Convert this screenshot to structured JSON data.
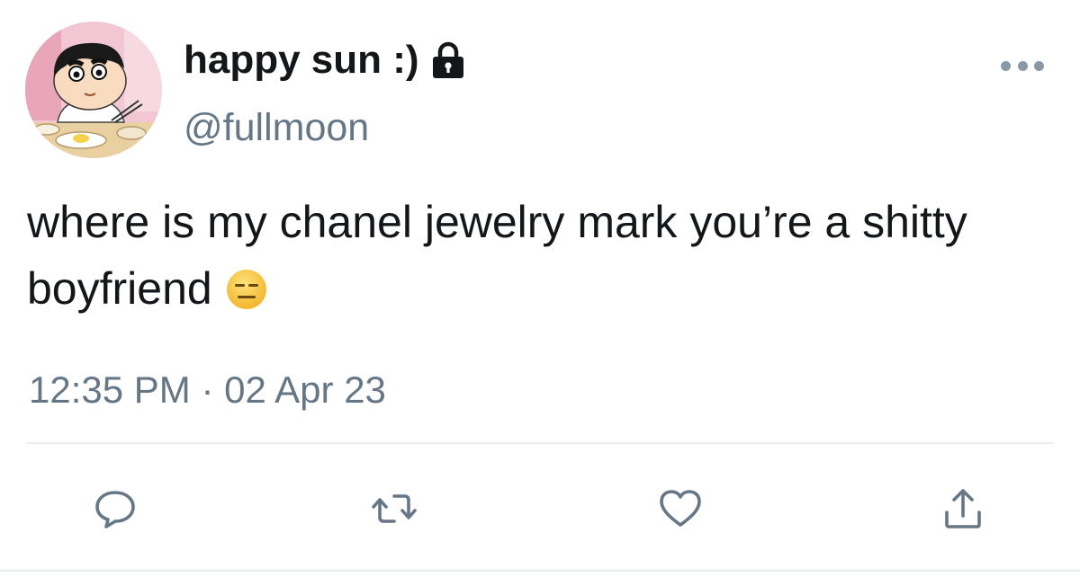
{
  "author": {
    "display_name": "happy sun :)",
    "handle": "@fullmoon",
    "protected_icon": "lock-icon",
    "avatar": "cartoon-boy-eating-avatar"
  },
  "tweet": {
    "text": "where is my chanel jewelry mark you’re a shitty boyfriend",
    "emoji": "expressionless-face-emoji",
    "timestamp": "12:35 PM · 02 Apr 23"
  },
  "actions": [
    {
      "name": "reply",
      "icon": "reply-icon"
    },
    {
      "name": "retweet",
      "icon": "retweet-icon"
    },
    {
      "name": "like",
      "icon": "heart-icon"
    },
    {
      "name": "share",
      "icon": "share-icon"
    }
  ],
  "colors": {
    "text_primary": "#14171a",
    "text_secondary": "#657786",
    "icon_gray": "#657786",
    "divider": "#e6ecf0",
    "emoji_yellow": "#f8c53a"
  }
}
